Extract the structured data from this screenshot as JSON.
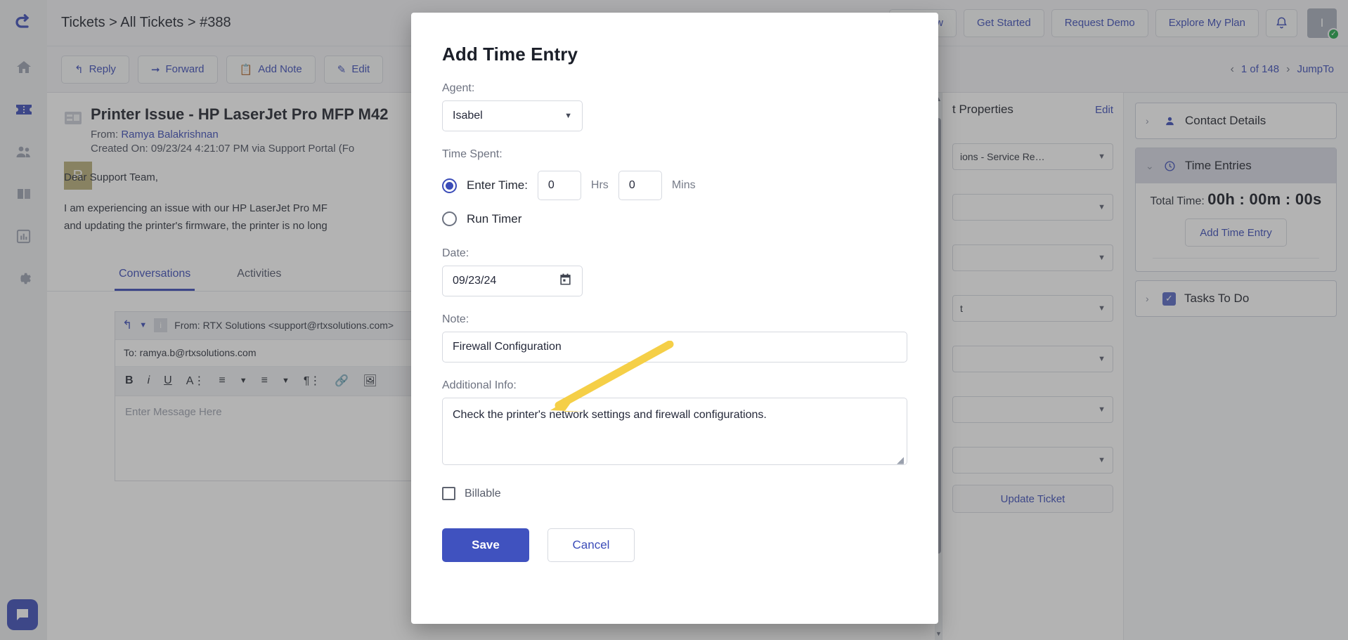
{
  "sidebar": {
    "items": [
      {
        "name": "home-icon",
        "label": "Home"
      },
      {
        "name": "tickets-icon",
        "label": "Tickets"
      },
      {
        "name": "contacts-icon",
        "label": "Contacts"
      },
      {
        "name": "knowledge-base-icon",
        "label": "Knowledge Base"
      },
      {
        "name": "reports-icon",
        "label": "Reports"
      },
      {
        "name": "settings-icon",
        "label": "Settings"
      }
    ]
  },
  "topbar": {
    "breadcrumb": "Tickets > All Tickets > #388",
    "new_label": "New",
    "get_started_label": "Get Started",
    "request_demo_label": "Request Demo",
    "explore_plan_label": "Explore My Plan",
    "avatar_initial": "I"
  },
  "actionbar": {
    "reply_label": "Reply",
    "forward_label": "Forward",
    "add_note_label": "Add Note",
    "edit_label": "Edit",
    "pager_text": "1 of 148",
    "jump_to_label": "JumpTo"
  },
  "ticket": {
    "title": "Printer Issue - HP LaserJet Pro MFP M42",
    "from_label": "From:",
    "from_name": "Ramya Balakrishnan",
    "created": "Created On: 09/23/24 4:21:07 PM via Support Portal (Fo",
    "avatar_initial": "R",
    "body_line1": "Dear Support Team,",
    "body_line2": "I am experiencing an issue with our HP LaserJet Pro MF",
    "body_line3": "and updating the printer's firmware, the printer is no long",
    "tabs": [
      {
        "label": "Conversations",
        "active": true
      },
      {
        "label": "Activities",
        "active": false
      }
    ]
  },
  "composer": {
    "from": "From:  RTX Solutions <support@rtxsolutions.com>",
    "to": "To: ramya.b@rtxsolutions.com",
    "placeholder": "Enter Message Here",
    "tools": [
      "bold-icon",
      "italic-icon",
      "underline-icon",
      "font-icon",
      "ordered-list-icon",
      "bullet-list-icon",
      "paragraph-icon",
      "link-icon",
      "image-icon"
    ]
  },
  "properties": {
    "title": "t Properties",
    "edit_label": "Edit",
    "fields": [
      {
        "value": "ions - Service Re…"
      },
      {
        "value": ""
      },
      {
        "value": ""
      },
      {
        "value": "t"
      },
      {
        "value": ""
      },
      {
        "value": ""
      },
      {
        "value": ""
      }
    ],
    "update_label": "Update Ticket"
  },
  "right_panel": {
    "contact_details": {
      "label": "Contact Details",
      "icon": "person-icon",
      "expanded": false
    },
    "time_entries": {
      "label": "Time Entries",
      "icon": "clock-icon",
      "expanded": true,
      "total_time_label": "Total Time:",
      "total_time_value": "00h : 00m : 00s",
      "add_time_entry_label": "Add Time Entry"
    },
    "tasks_to_do": {
      "label": "Tasks To Do",
      "icon": "checkbox-icon",
      "expanded": false
    }
  },
  "modal": {
    "title": "Add Time Entry",
    "agent_label": "Agent:",
    "agent_value": "Isabel",
    "time_spent_label": "Time Spent:",
    "enter_time_label": "Enter Time:",
    "hrs_value": "0",
    "hrs_unit": "Hrs",
    "mins_value": "0",
    "mins_unit": "Mins",
    "run_timer_label": "Run Timer",
    "date_label": "Date:",
    "date_value": "09/23/24",
    "note_label": "Note:",
    "note_value": "Firewall Configuration",
    "additional_info_label": "Additional Info:",
    "additional_info_value": "Check the printer's network settings and firewall configurations.",
    "billable_label": "Billable",
    "billable_checked": false,
    "save_label": "Save",
    "cancel_label": "Cancel"
  },
  "colors": {
    "accent": "#3b4cb8",
    "save_button": "#4052bf",
    "annotation_arrow": "#f5cf47",
    "status_online": "#21a74a"
  }
}
